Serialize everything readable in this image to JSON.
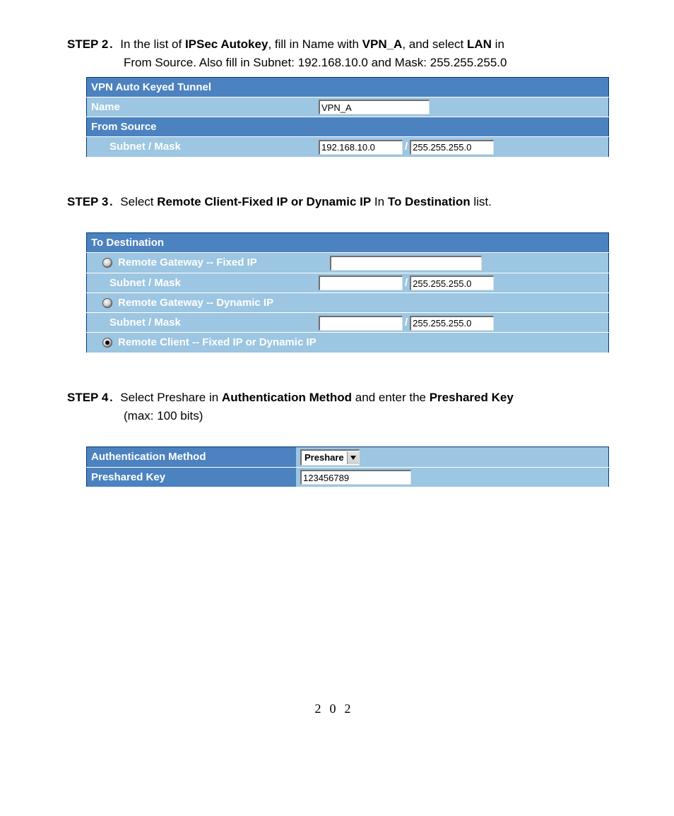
{
  "step2": {
    "label": "STEP 2",
    "sep": "．",
    "text_1a": "In the list of ",
    "text_1b": "IPSec Autokey",
    "text_1c": ", fill in Name with ",
    "text_1d": "VPN_A",
    "text_1e": ", and select ",
    "text_1f": "LAN",
    "text_1g": " in",
    "text_2": "From Source. Also fill in Subnet: 192.168.10.0 and Mask: 255.255.255.0",
    "table": {
      "hdr1": "VPN Auto Keyed Tunnel",
      "row_name_label": "Name",
      "row_name_value": "VPN_A",
      "hdr2": "From Source",
      "row_sub_label": "Subnet / Mask",
      "row_sub_subnet": "192.168.10.0",
      "row_sub_mask": "255.255.255.0"
    }
  },
  "step3": {
    "label": "STEP 3",
    "sep": "．",
    "text_a": "Select ",
    "text_b": "Remote Client-Fixed IP or Dynamic IP",
    "text_c": " In ",
    "text_d": "To Destination",
    "text_e": " list.",
    "table": {
      "hdr": "To Destination",
      "opt1": "Remote Gateway -- Fixed IP",
      "opt1_sub_label": "Subnet / Mask",
      "opt1_subnet": "",
      "opt1_mask": "255.255.255.0",
      "opt1_ip": "",
      "opt2": "Remote Gateway -- Dynamic IP",
      "opt2_sub_label": "Subnet / Mask",
      "opt2_subnet": "",
      "opt2_mask": "255.255.255.0",
      "opt3": "Remote Client -- Fixed IP or Dynamic IP"
    }
  },
  "step4": {
    "label": "STEP 4",
    "sep": "．",
    "text_a": "Select Preshare in ",
    "text_b": "Authentication Method",
    "text_c": " and enter the ",
    "text_d": "Preshared Key",
    "text_e": "(max: 100 bits)",
    "table": {
      "row1_label": "Authentication Method",
      "row1_value": "Preshare",
      "row2_label": "Preshared Key",
      "row2_value": "123456789"
    }
  },
  "page_number": "202"
}
